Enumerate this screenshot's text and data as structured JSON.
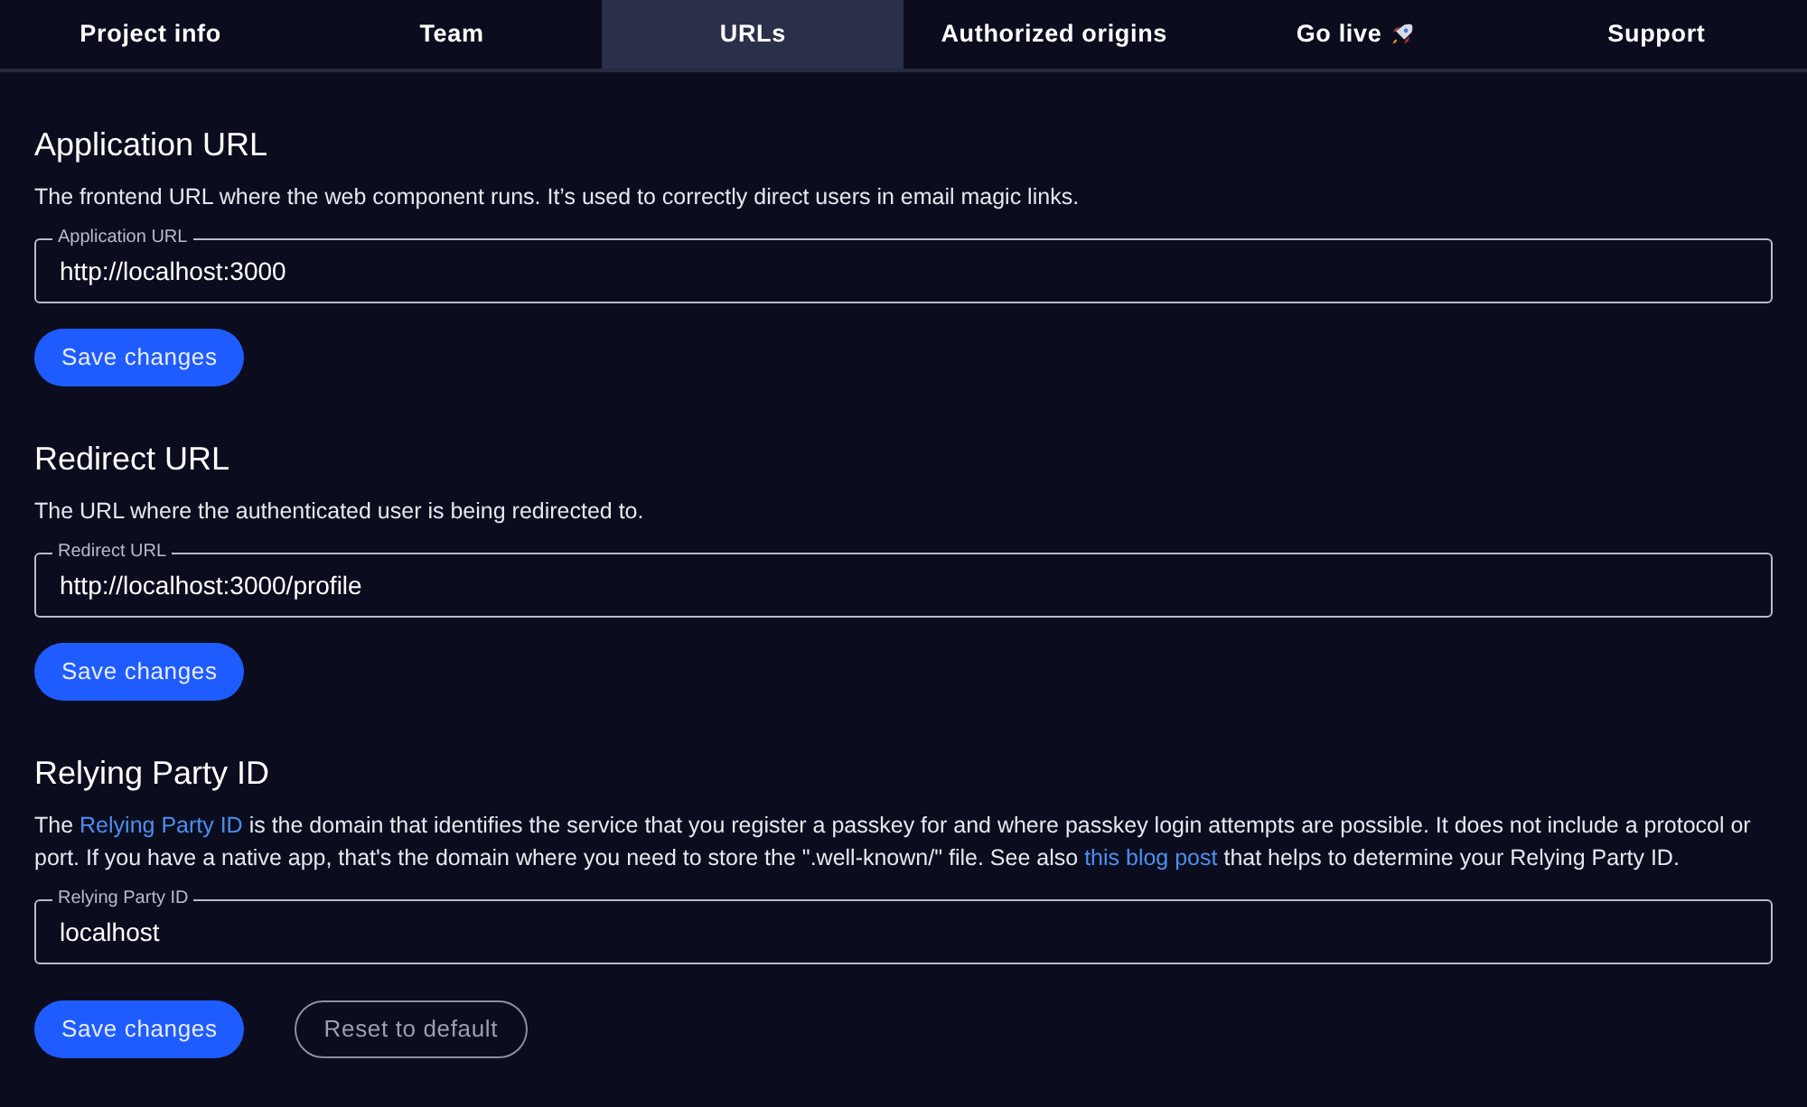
{
  "tabs": [
    {
      "label": "Project info",
      "selected": false
    },
    {
      "label": "Team",
      "selected": false
    },
    {
      "label": "URLs",
      "selected": true
    },
    {
      "label": "Authorized origins",
      "selected": false
    },
    {
      "label": "Go live",
      "selected": false,
      "kind": "rocket"
    },
    {
      "label": "Support",
      "selected": false
    }
  ],
  "sections": [
    {
      "title": "Application URL",
      "description": [
        {
          "kind": "text",
          "text": "The frontend URL where the web component runs. It’s used to correctly direct users in email magic links."
        }
      ],
      "field": {
        "label": "Application URL",
        "value": "http://localhost:3000"
      },
      "buttons": [
        {
          "kind": "primary",
          "label": "Save changes"
        }
      ]
    },
    {
      "title": "Redirect URL",
      "description": [
        {
          "kind": "text",
          "text": "The URL where the authenticated user is being redirected to."
        }
      ],
      "field": {
        "label": "Redirect URL",
        "value": "http://localhost:3000/profile"
      },
      "buttons": [
        {
          "kind": "primary",
          "label": "Save changes"
        }
      ]
    },
    {
      "title": "Relying Party ID",
      "description": [
        {
          "kind": "text",
          "text": "The"
        },
        {
          "kind": "link",
          "text": "Relying Party ID"
        },
        {
          "kind": "text",
          "text": "is the domain that identifies the service that you register a passkey for and where passkey login attempts are possible. It does not include a protocol or port. If you have a native app, that's the domain where you need to store the \".well-known/\" file. See also"
        },
        {
          "kind": "link",
          "text": "this blog post"
        },
        {
          "kind": "text",
          "text": "that helps to determine your Relying Party ID."
        }
      ],
      "field": {
        "label": "Relying Party ID",
        "value": "localhost"
      },
      "buttons": [
        {
          "kind": "primary",
          "label": "Save changes"
        },
        {
          "kind": "outline",
          "label": "Reset to default"
        }
      ]
    }
  ]
}
